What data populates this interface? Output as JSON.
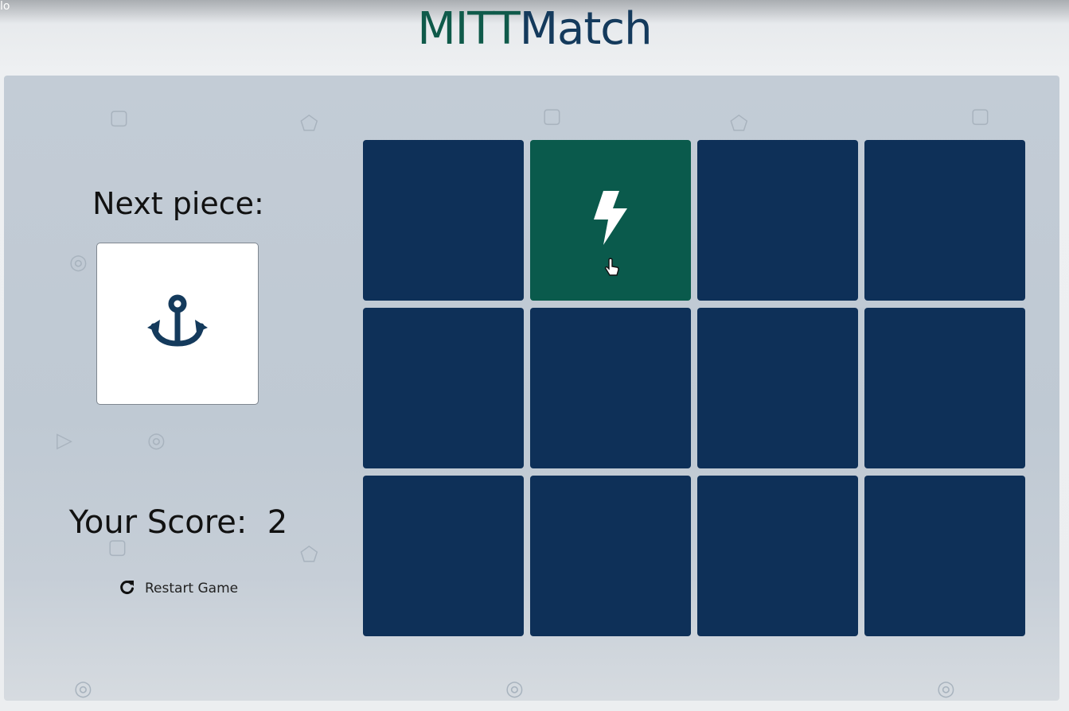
{
  "corner_text": "lo",
  "title": {
    "part1": "MITT",
    "part2": "Match",
    "color_part1": "#0f5a4a",
    "color_part2": "#143a5c"
  },
  "sidebar": {
    "next_label": "Next piece:",
    "next_piece_icon": "anchor-icon",
    "score_label": "Your Score:",
    "score_value": "2",
    "restart_label": "Restart Game",
    "restart_icon": "refresh-icon"
  },
  "board": {
    "rows": 3,
    "cols": 4,
    "tile_color": "#0e3058",
    "revealed_color": "#0a5a4c",
    "tiles": [
      {
        "state": "hidden",
        "icon": ""
      },
      {
        "state": "revealed",
        "icon": "lightning-icon"
      },
      {
        "state": "hidden",
        "icon": ""
      },
      {
        "state": "hidden",
        "icon": ""
      },
      {
        "state": "hidden",
        "icon": ""
      },
      {
        "state": "hidden",
        "icon": ""
      },
      {
        "state": "hidden",
        "icon": ""
      },
      {
        "state": "hidden",
        "icon": ""
      },
      {
        "state": "hidden",
        "icon": ""
      },
      {
        "state": "hidden",
        "icon": ""
      },
      {
        "state": "hidden",
        "icon": ""
      },
      {
        "state": "hidden",
        "icon": ""
      }
    ]
  }
}
